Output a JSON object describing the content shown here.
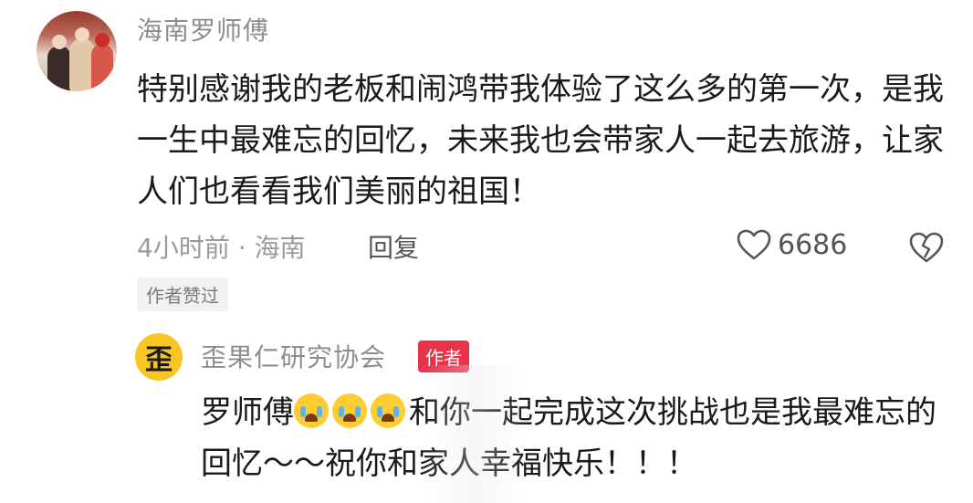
{
  "comment": {
    "username": "海南罗师傅",
    "text": "特别感谢我的老板和闹鸿带我体验了这么多的第一次，是我一生中最难忘的回忆，未来我也会带家人一起去旅游，让家人们也看看我们美丽的祖国！",
    "meta": "4小时前 · 海南",
    "reply_label": "回复",
    "like_count": "6686",
    "author_liked_tag": "作者赞过",
    "icons": [
      "heart-icon",
      "broken-heart-icon"
    ]
  },
  "reply": {
    "avatar_char": "歪",
    "username": "歪果仁研究协会",
    "badge": "作者",
    "text_prefix": "罗师傅",
    "emoji_count": 3,
    "text_suffix": "和你一起完成这次挑战也是我最难忘的回忆～～祝你和家人幸福快乐！！！",
    "colors": {
      "avatar_bg": "#f7c624",
      "badge_bg": "#e8334a",
      "emoji": "#ffcc33"
    }
  }
}
